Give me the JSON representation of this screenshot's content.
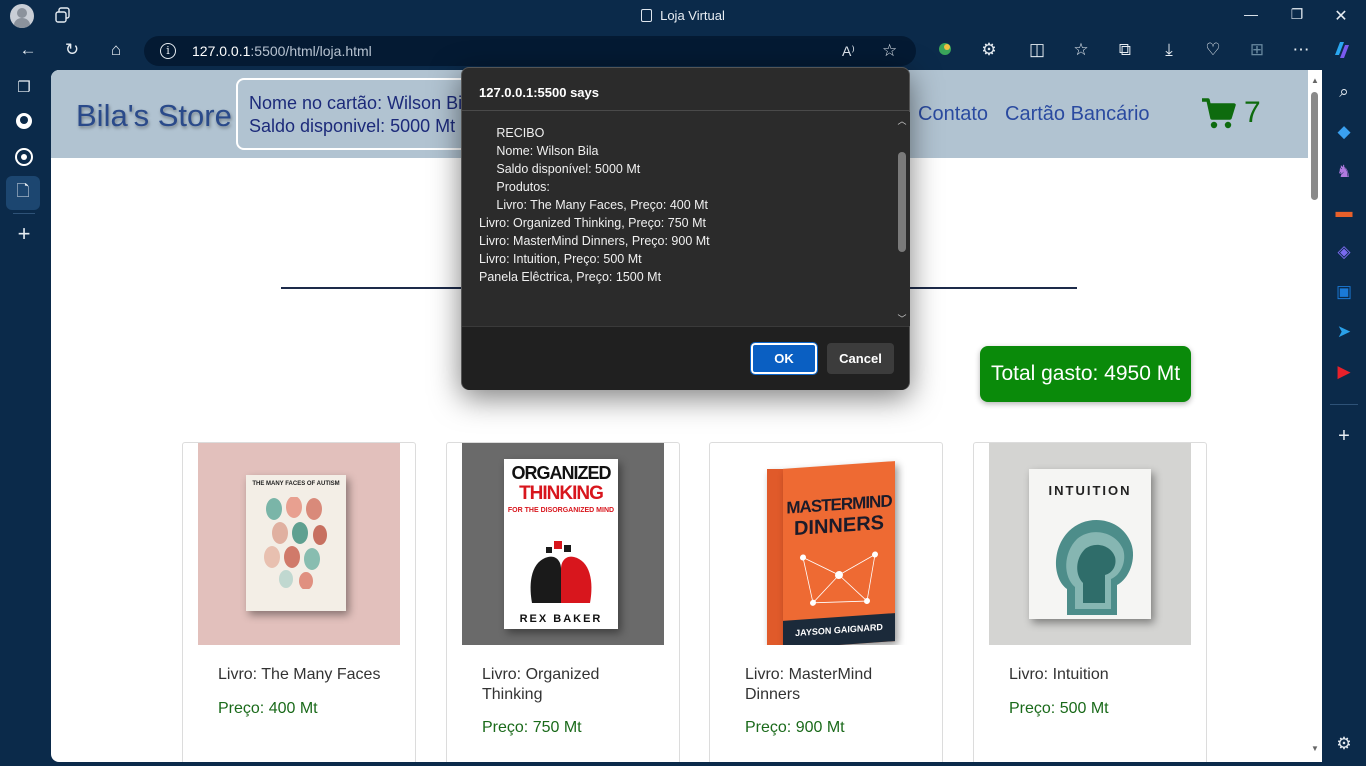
{
  "browser": {
    "window_title": "Loja Virtual",
    "url_host": "127.0.0.1",
    "url_rest": ":5500/html/loja.html"
  },
  "site": {
    "logo": "Bila's Store",
    "card_name_line": "Nome no cartão: Wilson Bila",
    "card_balance_line": "Saldo disponivel: 5000 Mt",
    "nav": [
      "Contato",
      "Cartão Bancário"
    ],
    "cart_count": "7",
    "total": "Total gasto: 4950 Mt",
    "products": [
      {
        "name": "Livro: The Many Faces",
        "price": "Preço: 400 Mt",
        "cover_title": "THE MANY FACES OF AUTISM"
      },
      {
        "name": "Livro: Organized Thinking",
        "price": "Preço: 750 Mt",
        "cover_title_1": "ORGANIZED",
        "cover_title_2": "THINKING",
        "cover_sub": "FOR THE DISORGANIZED MIND",
        "cover_author": "REX BAKER"
      },
      {
        "name": "Livro: MasterMind Dinners",
        "price": "Preço: 900 Mt",
        "cover_title_1": "MASTERMIND",
        "cover_title_2": "DINNERS",
        "cover_author": "JAYSON GAIGNARD"
      },
      {
        "name": "Livro: Intuition",
        "price": "Preço: 500 Mt",
        "cover_title": "INTUITION"
      }
    ]
  },
  "dialog": {
    "title": "127.0.0.1:5500 says",
    "lines": [
      "     RECIBO",
      "",
      "     Nome: Wilson Bila",
      "     Saldo disponível: 5000 Mt",
      "",
      "     Produtos:",
      "     Livro: The Many Faces, Preço: 400 Mt",
      "Livro: Organized Thinking, Preço: 750 Mt",
      "Livro: MasterMind Dinners, Preço: 900 Mt",
      "Livro: Intuition, Preço: 500 Mt",
      "Panela Elêctrica, Preço: 1500 Mt"
    ],
    "ok_label": "OK",
    "cancel_label": "Cancel"
  }
}
